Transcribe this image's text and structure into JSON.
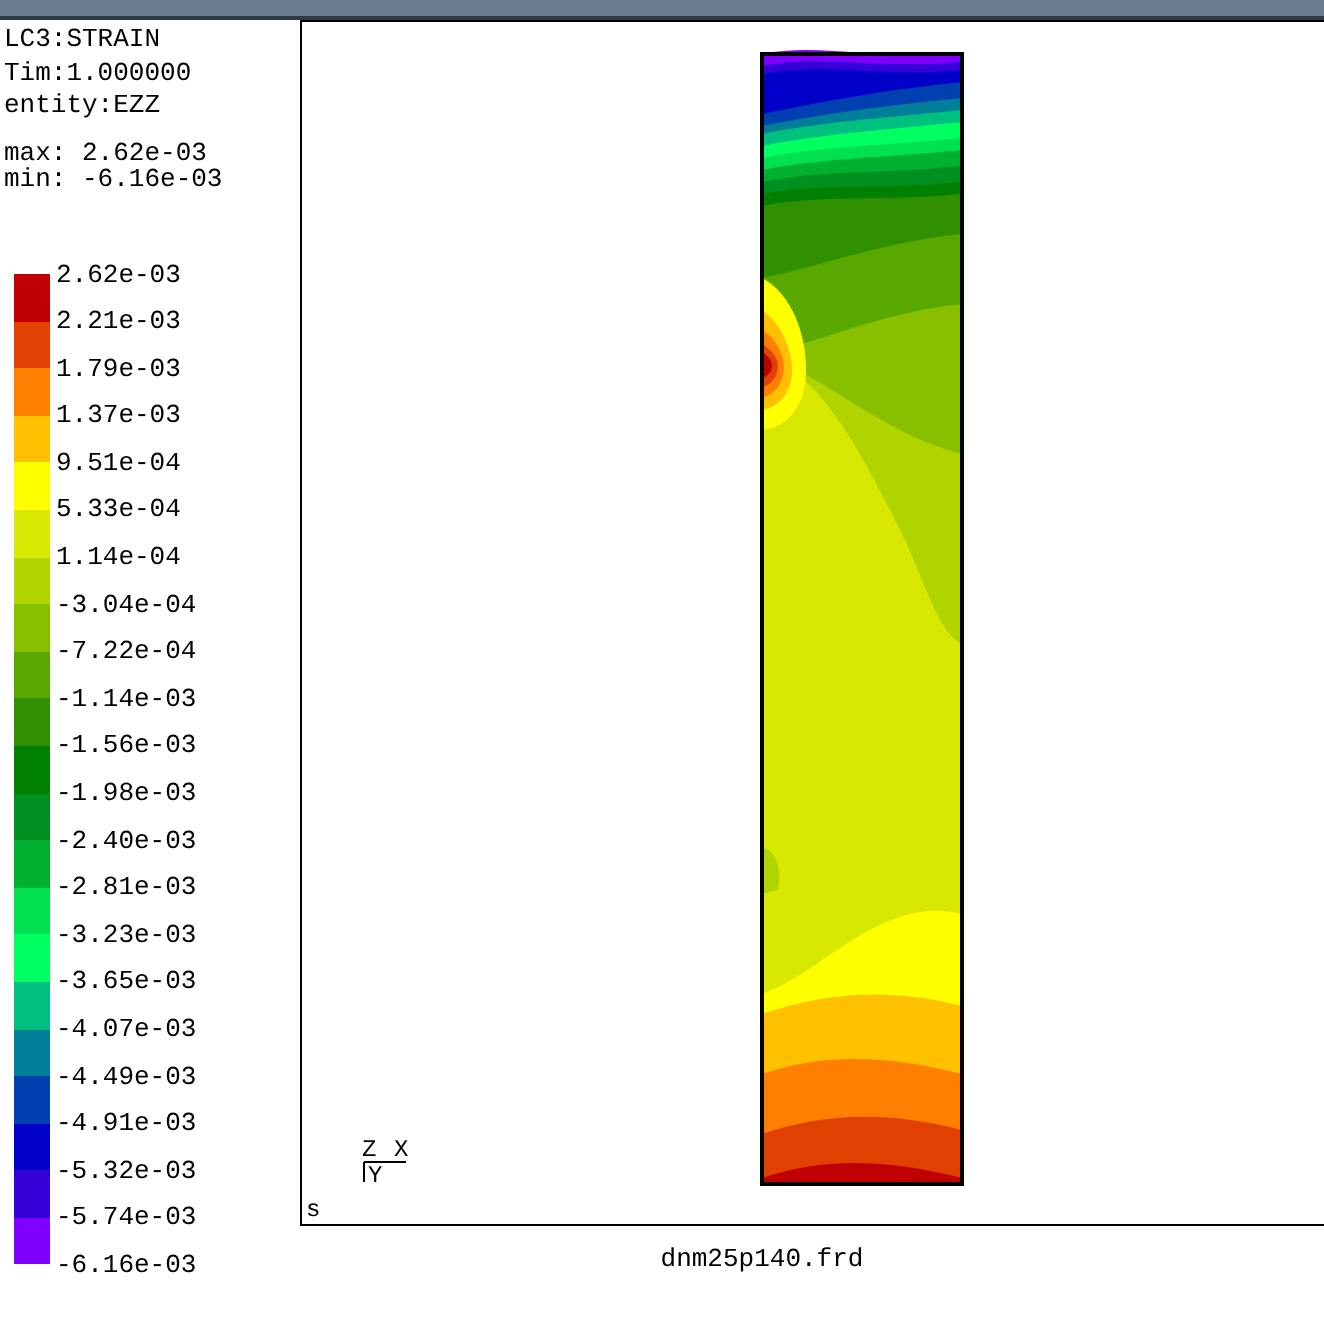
{
  "header": [
    "LC3:STRAIN",
    "Tim:1.000000",
    "entity:EZZ"
  ],
  "extrema": [
    "max: 2.62e-03",
    "min: -6.16e-03"
  ],
  "legend": {
    "labels": [
      "2.62e-03",
      "2.21e-03",
      "1.79e-03",
      "1.37e-03",
      "9.51e-04",
      "5.33e-04",
      "1.14e-04",
      "-3.04e-04",
      "-7.22e-04",
      "-1.14e-03",
      "-1.56e-03",
      "-1.98e-03",
      "-2.40e-03",
      "-2.81e-03",
      "-3.23e-03",
      "-3.65e-03",
      "-4.07e-03",
      "-4.49e-03",
      "-4.91e-03",
      "-5.32e-03",
      "-5.74e-03",
      "-6.16e-03"
    ],
    "bands": [
      {
        "color": "#c00000"
      },
      {
        "color": "#e04000"
      },
      {
        "color": "#ff8000"
      },
      {
        "color": "#ffc000"
      },
      {
        "color": "#ffff00"
      },
      {
        "color": "#d8e800"
      },
      {
        "color": "#b0d400"
      },
      {
        "color": "#88c000"
      },
      {
        "color": "#58a800"
      },
      {
        "color": "#309000"
      },
      {
        "color": "#008000"
      },
      {
        "color": "#009020"
      },
      {
        "color": "#00b030"
      },
      {
        "color": "#00e050"
      },
      {
        "color": "#00ff60"
      },
      {
        "color": "#00c080"
      },
      {
        "color": "#008098"
      },
      {
        "color": "#0040b0"
      },
      {
        "color": "#0000c8"
      },
      {
        "color": "#3800d8"
      },
      {
        "color": "#8000ff"
      }
    ]
  },
  "viewport": {
    "axes": [
      "Z",
      "X",
      "Y"
    ],
    "corner_label": "s"
  },
  "file_name": "dnm25p140.frd"
}
